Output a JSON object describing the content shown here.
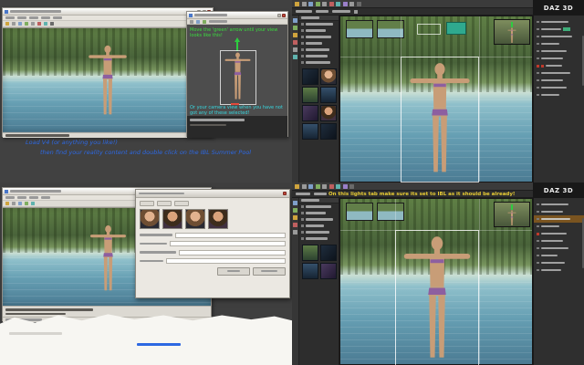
{
  "logos": {
    "daz": "DAZ 3D"
  },
  "top_left": {
    "notes": {
      "green": "Move the 'green' arrow until your view looks like this!",
      "cyan": "Or your camera view when you have not got any of these selected!",
      "blue1": "Load V4 (or anything you like!)",
      "blue2": "then find your reality content and double click on the IBL Summer Pool"
    }
  },
  "bottom_right": {
    "yellow_note": "On this lights tab make sure its set to IBL as it should be already!"
  },
  "colors": {
    "annotation_green": "#3bdc3f",
    "annotation_cyan": "#38d6de",
    "annotation_blue": "#2d68e2",
    "annotation_yellow": "#e8cc35",
    "teal_selection": "#2fa98e",
    "skin": "#c89d77",
    "bikini": "#8d5fa0"
  }
}
